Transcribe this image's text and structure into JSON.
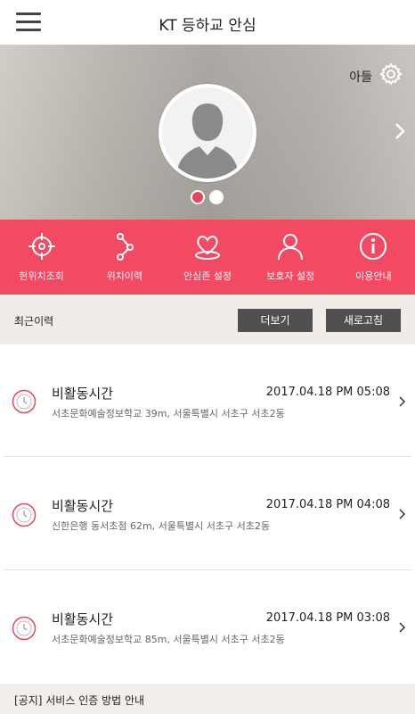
{
  "header": {
    "title": "KT 등하교 안심",
    "menu_icon": "hamburger-menu-icon"
  },
  "profile": {
    "child_name": "아들",
    "settings_icon": "gear-icon",
    "avatar_icon": "person-silhouette-icon",
    "next_icon": "chevron-right-icon",
    "page_count": 2,
    "active_page": 1
  },
  "quick_menu": {
    "background": "#f24a62",
    "items": [
      {
        "label": "현위치조회",
        "icon": "crosshair-icon"
      },
      {
        "label": "위치이력",
        "icon": "route-nodes-icon"
      },
      {
        "label": "안심존 설정",
        "icon": "heart-zone-icon"
      },
      {
        "label": "보호자 설정",
        "icon": "person-icon"
      },
      {
        "label": "이용안내",
        "icon": "info-icon"
      }
    ]
  },
  "recent": {
    "title": "최근이력",
    "more_label": "더보기",
    "refresh_label": "새로고침"
  },
  "history": [
    {
      "type": "비활동시간",
      "time": "2017.04.18 PM 05:08",
      "location": "서초문화예술정보학교 39m, 서울특별시 서초구 서초2동",
      "icon": "clock-icon"
    },
    {
      "type": "비활동시간",
      "time": "2017.04.18 PM 04:08",
      "location": "신한은행 동서초점 62m, 서울특별시 서초구 서초2동",
      "icon": "clock-icon"
    },
    {
      "type": "비활동시간",
      "time": "2017.04.18 PM 03:08",
      "location": "서초문화예술정보학교 85m, 서울특별시 서초구 서초2동",
      "icon": "clock-icon"
    }
  ],
  "notice": {
    "text": "[공지] 서비스 인증 방법 안내"
  },
  "colors": {
    "accent": "#f24a62",
    "button": "#505050",
    "active_dot": "#e8465c"
  }
}
